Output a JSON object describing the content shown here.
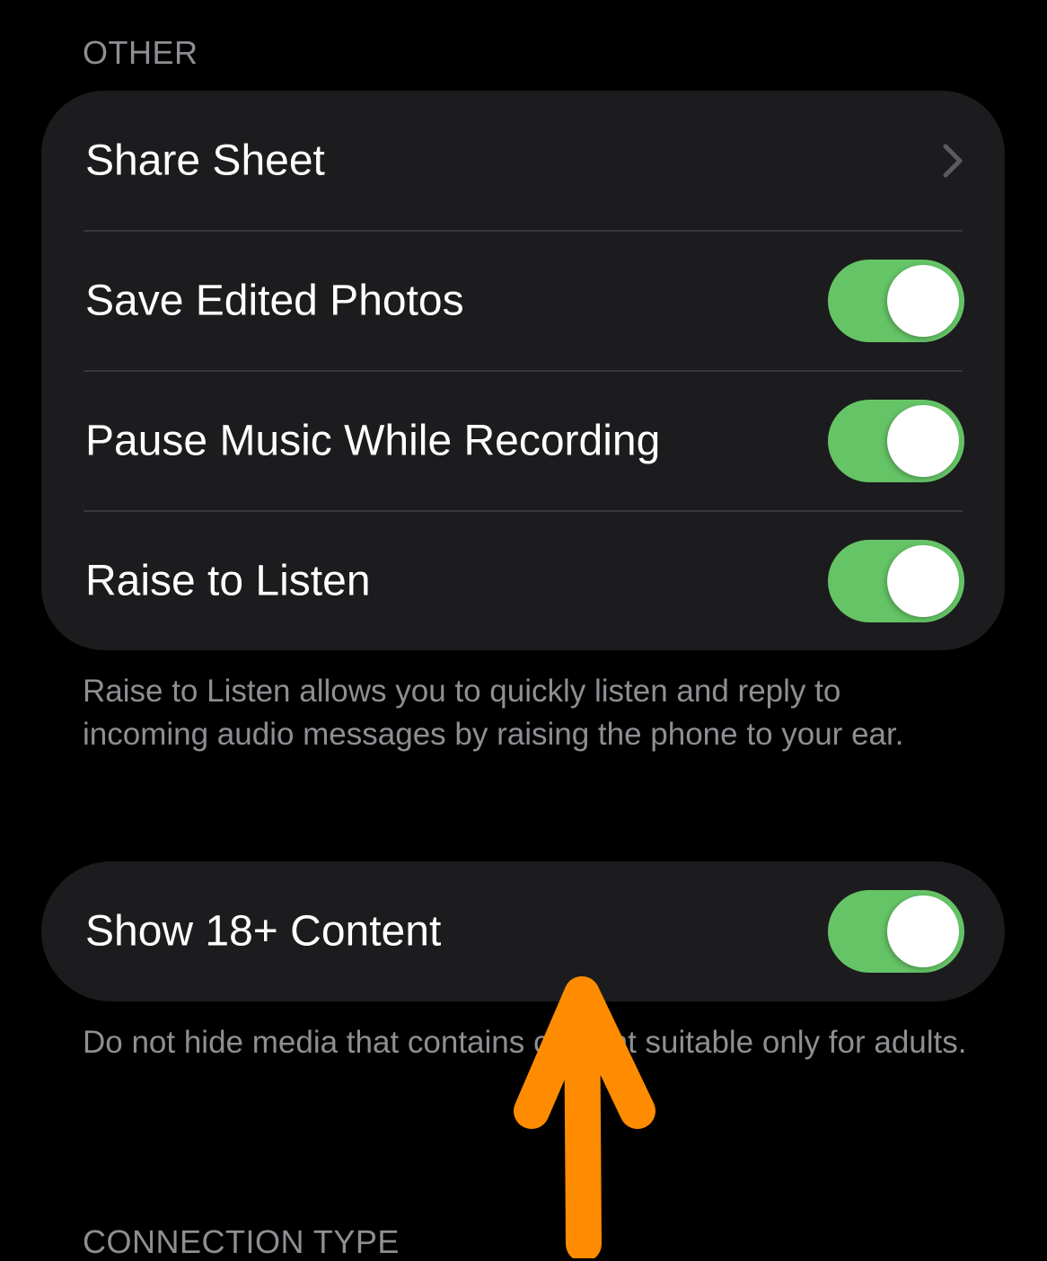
{
  "sections": {
    "other": {
      "header": "OTHER",
      "rows": [
        {
          "label": "Share Sheet",
          "control": "chevron"
        },
        {
          "label": "Save Edited Photos",
          "control": "toggle",
          "on": true
        },
        {
          "label": "Pause Music While Recording",
          "control": "toggle",
          "on": true
        },
        {
          "label": "Raise to Listen",
          "control": "toggle",
          "on": true
        }
      ],
      "footer": "Raise to Listen allows you to quickly listen and reply to incoming audio messages by raising the phone to your ear."
    },
    "adult": {
      "rows": [
        {
          "label": "Show 18+ Content",
          "control": "toggle",
          "on": true
        }
      ],
      "footer": "Do not hide media that contains content suitable only for adults."
    },
    "connection": {
      "header": "CONNECTION TYPE"
    }
  },
  "colors": {
    "background": "#000000",
    "group_background": "#1c1c1e",
    "toggle_on": "#65c466",
    "secondary_text": "#8e8e93",
    "annotation_arrow": "#ff8c00"
  },
  "icons": {
    "chevron": "chevron-right-icon",
    "annotation": "arrow-up-icon"
  }
}
